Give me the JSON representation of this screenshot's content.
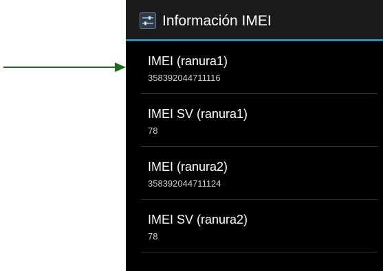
{
  "app": {
    "title": "Información IMEI",
    "icon": "settings-sliders-icon"
  },
  "items": [
    {
      "label": "IMEI (ranura1)",
      "value": "358392044711116"
    },
    {
      "label": "IMEI SV (ranura1)",
      "value": "78"
    },
    {
      "label": "IMEI (ranura2)",
      "value": "358392044711124"
    },
    {
      "label": "IMEI SV (ranura2)",
      "value": "78"
    }
  ],
  "colors": {
    "background": "#000000",
    "action_bar": "#1b1b1b",
    "accent": "#2a8fb8",
    "arrow": "#1d6b1d"
  }
}
